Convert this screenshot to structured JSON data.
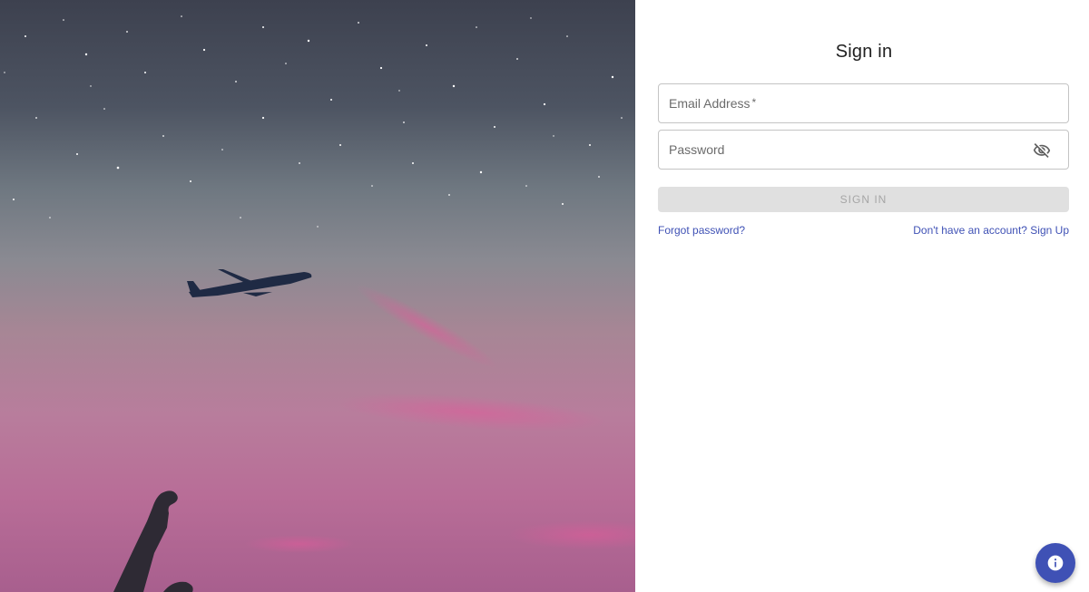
{
  "sign_in_form": {
    "title": "Sign in",
    "email_label": "Email Address",
    "email_required_marker": "*",
    "email_value": "",
    "password_label": "Password",
    "password_value": "",
    "password_visibility_icon": "eye-off-icon",
    "submit_label": "SIGN IN",
    "forgot_password_link": "Forgot password?",
    "sign_up_link": "Don't have an account? Sign Up"
  },
  "hero_image": {
    "subject": "airplane flying in starry pink dusk sky with raised hand"
  },
  "help_fab": {
    "icon": "info-icon"
  },
  "colors": {
    "primary": "#3f51b5",
    "disabled_button_bg": "#e0e0e0",
    "disabled_button_text": "#a6a6a6",
    "input_border": "#c4c4c4"
  }
}
